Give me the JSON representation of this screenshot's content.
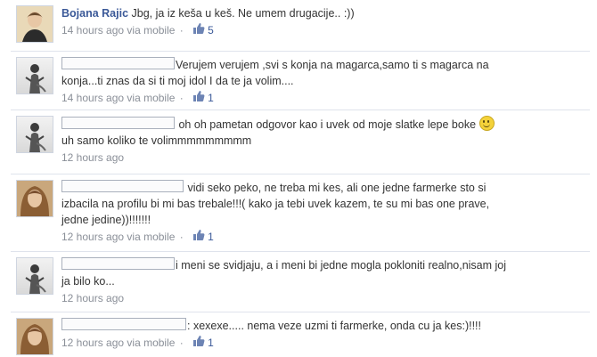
{
  "colors": {
    "link": "#3b5998",
    "meta": "#8a8f98",
    "text": "#333333"
  },
  "comments": [
    {
      "author": "Bojana Rajic",
      "text": "Jbg, ja iz keša u keš. Ne umem drugacije.. :))",
      "time": "14 hours ago",
      "via": "via mobile",
      "likes": "5"
    },
    {
      "author": "",
      "text_line1": "Verujem verujem ,svi s konja na magarca,samo ti s magarca na",
      "text_line2": "konja...ti znas da si ti moj idol I da te ja volim....",
      "time": "14 hours ago",
      "via": "via mobile",
      "likes": "1"
    },
    {
      "author": "",
      "text_line1": "oh oh pametan odgovor kao i uvek od moje slatke lepe boke",
      "emoticon": "smile-emoticon",
      "text_line2": "uh samo koliko te volimmmmmmmmm",
      "time": "12 hours ago"
    },
    {
      "author": "",
      "text_line1": "vidi seko peko, ne treba mi kes, ali one jedne farmerke sto si",
      "text_line2": "izbacila na profilu bi mi bas trebale!!!( kako ja tebi uvek kazem, te su mi bas one prave,",
      "text_line3": "jedne jedine))!!!!!!!",
      "time": "12 hours ago",
      "via": "via mobile",
      "likes": "1"
    },
    {
      "author": "",
      "text_line1": "i meni se svidjaju, a i meni bi jedne mogla pokloniti realno,nisam joj",
      "text_line2": "ja bilo ko...",
      "time": "12 hours ago"
    },
    {
      "author": "",
      "text_line1": ": xexexe..... nema veze uzmi ti farmerke, onda cu ja kes:)!!!!",
      "time": "12 hours ago",
      "via": "via mobile",
      "likes": "1"
    }
  ]
}
